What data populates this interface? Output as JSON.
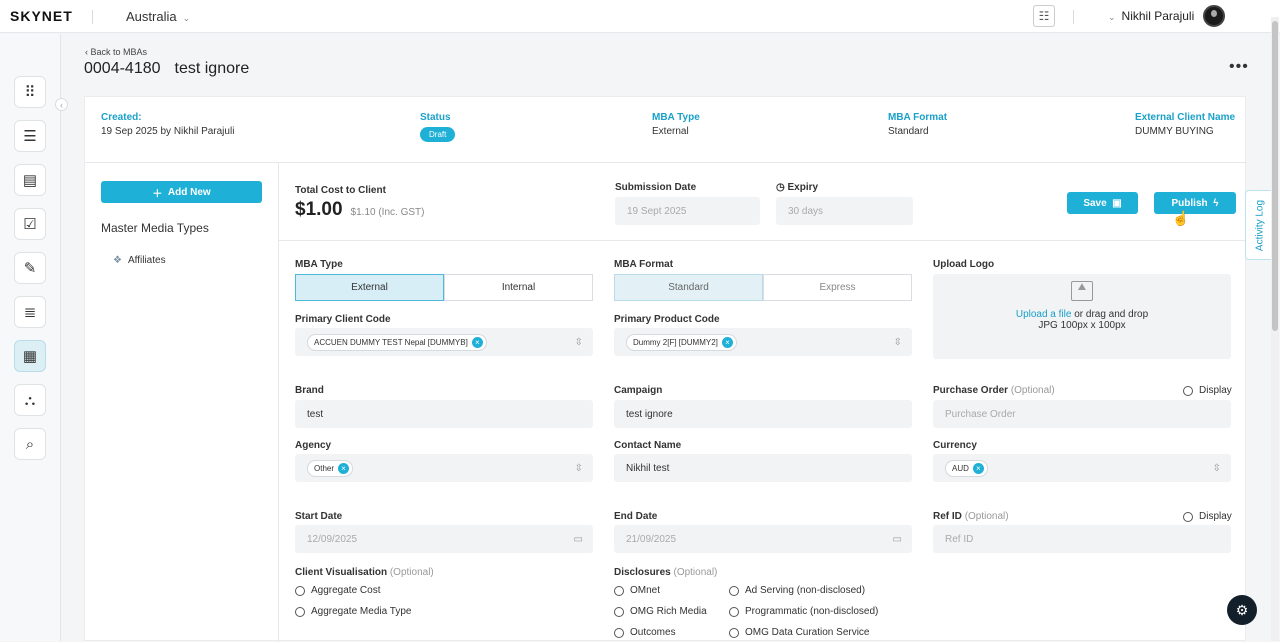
{
  "app": {
    "logo": "SKYNET",
    "region": "Australia"
  },
  "user": {
    "name": "Nikhil Parajuli"
  },
  "nav": {
    "collapse_icon": "‹"
  },
  "page": {
    "back": "Back to MBAs",
    "id": "0004-4180",
    "name": "test ignore",
    "more": "•••"
  },
  "meta": {
    "created_label": "Created:",
    "created_value": "19 Sep 2025 by Nikhil Parajuli",
    "status_label": "Status",
    "status_value": "Draft",
    "mba_type_label": "MBA Type",
    "mba_type_value": "External",
    "mba_format_label": "MBA Format",
    "mba_format_value": "Standard",
    "ext_client_label": "External Client Name",
    "ext_client_value": "DUMMY BUYING"
  },
  "left": {
    "add_new": "Add New",
    "master_title": "Master Media Types",
    "items": [
      "Affiliates"
    ]
  },
  "cost": {
    "label": "Total Cost to Client",
    "amount": "$1.00",
    "inc_gst": "$1.10 (Inc. GST)"
  },
  "submission": {
    "label": "Submission Date",
    "value": "19 Sept 2025"
  },
  "expiry": {
    "label": "Expiry",
    "placeholder": "30 days"
  },
  "actions": {
    "save": "Save",
    "publish": "Publish"
  },
  "form": {
    "mba_type": {
      "label": "MBA Type",
      "options": [
        "External",
        "Internal"
      ]
    },
    "mba_format": {
      "label": "MBA Format",
      "options": [
        "Standard",
        "Express"
      ]
    },
    "upload": {
      "label": "Upload Logo",
      "link": "Upload a file",
      "rest": " or drag and drop",
      "hint": "JPG 100px x 100px"
    },
    "primary_client": {
      "label": "Primary Client Code",
      "tag": "ACCUEN DUMMY TEST Nepal [DUMMYB]"
    },
    "primary_product": {
      "label": "Primary Product Code",
      "tag": "Dummy 2[F] [DUMMY2]"
    },
    "brand": {
      "label": "Brand",
      "value": "test"
    },
    "campaign": {
      "label": "Campaign",
      "value": "test ignore"
    },
    "po": {
      "label": "Purchase Order",
      "optional": "(Optional)",
      "placeholder": "Purchase Order",
      "display": "Display"
    },
    "agency": {
      "label": "Agency",
      "tag": "Other"
    },
    "contact": {
      "label": "Contact Name",
      "value": "Nikhil test"
    },
    "currency": {
      "label": "Currency",
      "tag": "AUD"
    },
    "start": {
      "label": "Start Date",
      "value": "12/09/2025"
    },
    "end": {
      "label": "End Date",
      "value": "21/09/2025"
    },
    "ref": {
      "label": "Ref ID",
      "optional": "(Optional)",
      "placeholder": "Ref ID",
      "display": "Display"
    },
    "client_vis": {
      "label": "Client Visualisation",
      "optional": "(Optional)",
      "options": [
        "Aggregate Cost",
        "Aggregate Media Type"
      ]
    },
    "disclosures": {
      "label": "Disclosures",
      "optional": "(Optional)",
      "col1": [
        "OMnet",
        "OMG Rich Media",
        "Outcomes"
      ],
      "col2": [
        "Ad Serving (non-disclosed)",
        "Programmatic (non-disclosed)",
        "OMG Data Curation Service"
      ]
    }
  },
  "activity_log": "Activity Log"
}
